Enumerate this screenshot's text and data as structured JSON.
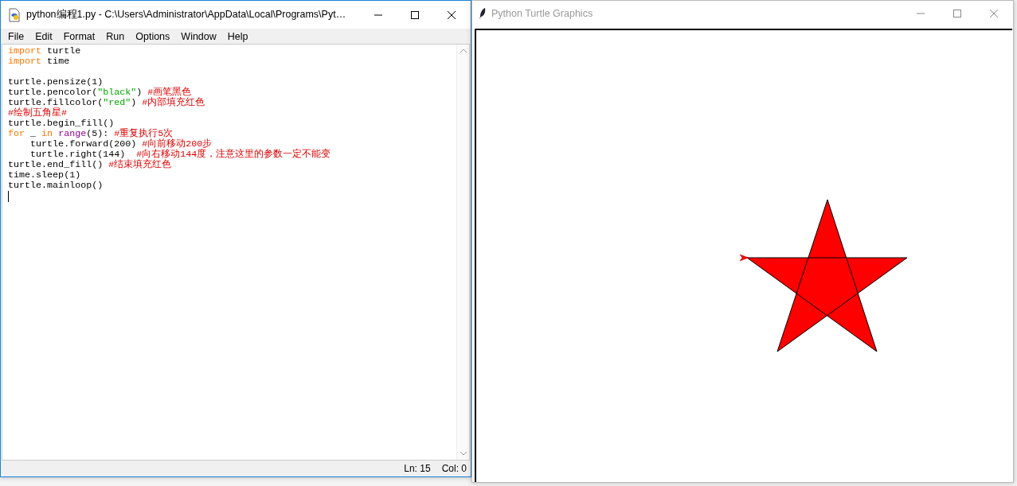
{
  "editor_window": {
    "title": "python编程1.py - C:\\Users\\Administrator\\AppData\\Local\\Programs\\Pyt…",
    "active": true,
    "menu": [
      "File",
      "Edit",
      "Format",
      "Run",
      "Options",
      "Window",
      "Help"
    ],
    "code_lines": [
      {
        "kind": "code",
        "tokens": [
          {
            "kind": "keyword",
            "text": "import"
          },
          {
            "kind": "plain",
            "text": " turtle"
          }
        ]
      },
      {
        "kind": "code",
        "tokens": [
          {
            "kind": "keyword",
            "text": "import"
          },
          {
            "kind": "plain",
            "text": " time"
          }
        ]
      },
      {
        "kind": "blank"
      },
      {
        "kind": "code",
        "tokens": [
          {
            "kind": "plain",
            "text": "turtle.pensize(1)"
          }
        ]
      },
      {
        "kind": "code",
        "tokens": [
          {
            "kind": "plain",
            "text": "turtle.pencolor("
          },
          {
            "kind": "string",
            "text": "\"black\""
          },
          {
            "kind": "plain",
            "text": ") "
          },
          {
            "kind": "comment",
            "text": "#画笔黑色"
          }
        ]
      },
      {
        "kind": "code",
        "tokens": [
          {
            "kind": "plain",
            "text": "turtle.fillcolor("
          },
          {
            "kind": "string",
            "text": "\"red\""
          },
          {
            "kind": "plain",
            "text": ") "
          },
          {
            "kind": "comment",
            "text": "#内部填充红色"
          }
        ]
      },
      {
        "kind": "code",
        "tokens": [
          {
            "kind": "comment",
            "text": "#绘制五角星#"
          }
        ]
      },
      {
        "kind": "code",
        "tokens": [
          {
            "kind": "plain",
            "text": "turtle.begin_fill()"
          }
        ]
      },
      {
        "kind": "code",
        "tokens": [
          {
            "kind": "keyword",
            "text": "for"
          },
          {
            "kind": "plain",
            "text": " _ "
          },
          {
            "kind": "keyword",
            "text": "in "
          },
          {
            "kind": "builtin",
            "text": "range"
          },
          {
            "kind": "plain",
            "text": "(5): "
          },
          {
            "kind": "comment",
            "text": "#重复执行5次"
          }
        ]
      },
      {
        "kind": "code",
        "tokens": [
          {
            "kind": "plain",
            "text": "    turtle.forward(200) "
          },
          {
            "kind": "comment",
            "text": "#向前移动200步"
          }
        ]
      },
      {
        "kind": "code",
        "tokens": [
          {
            "kind": "plain",
            "text": "    turtle.right(144)  "
          },
          {
            "kind": "comment",
            "text": "#向右移动144度，注意这里的参数一定不能变"
          }
        ]
      },
      {
        "kind": "code",
        "tokens": [
          {
            "kind": "plain",
            "text": "turtle.end_fill() "
          },
          {
            "kind": "comment",
            "text": "#结束填充红色"
          }
        ]
      },
      {
        "kind": "code",
        "tokens": [
          {
            "kind": "plain",
            "text": "time.sleep(1)"
          }
        ]
      },
      {
        "kind": "code",
        "tokens": [
          {
            "kind": "plain",
            "text": "turtle.mainloop()"
          }
        ]
      }
    ],
    "status_bar": {
      "line": "Ln: 15",
      "column": "Col: 0"
    }
  },
  "turtle_window": {
    "title": "Python Turtle Graphics",
    "active": false
  }
}
